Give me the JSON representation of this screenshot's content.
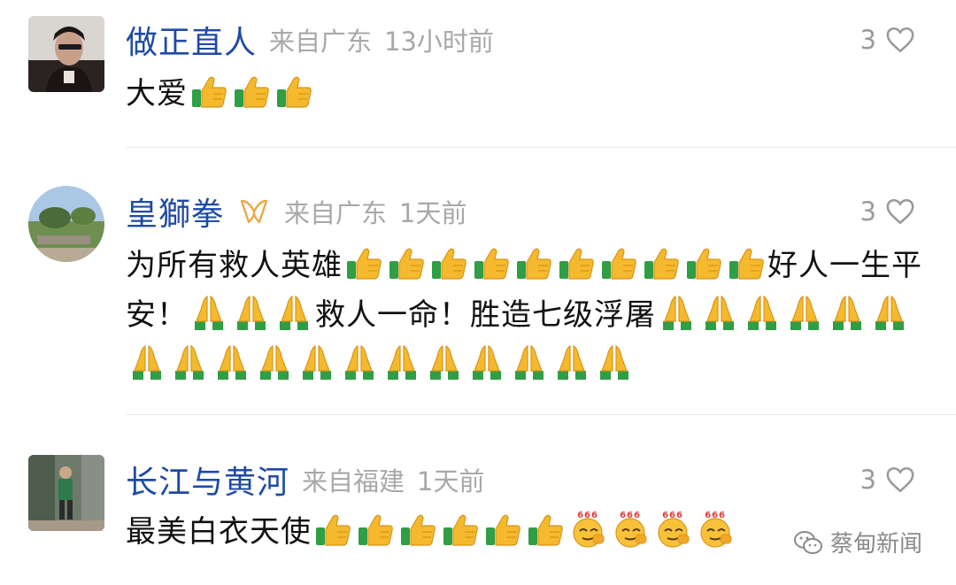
{
  "comments": [
    {
      "username": "做正直人",
      "location": "来自广东",
      "time": "13小时前",
      "likes": "3",
      "text": "大爱",
      "text_emojis": [
        "thumbs-up",
        "thumbs-up",
        "thumbs-up"
      ]
    },
    {
      "username": "皇獅拳",
      "location": "来自广东",
      "time": "1天前",
      "likes": "3",
      "text_parts": [
        {
          "t": "text",
          "v": "为所有救人英雄"
        },
        {
          "t": "emoji",
          "v": "thumbs-up",
          "n": 10
        },
        {
          "t": "text",
          "v": "好人一生平安！"
        },
        {
          "t": "emoji",
          "v": "pray",
          "n": 3
        },
        {
          "t": "text",
          "v": "救人一命！胜造七级浮屠"
        },
        {
          "t": "emoji",
          "v": "pray",
          "n": 18
        }
      ]
    },
    {
      "username": "长江与黄河",
      "location": "来自福建",
      "time": "1天前",
      "likes": "3",
      "text_parts": [
        {
          "t": "text",
          "v": "最美白衣天使"
        },
        {
          "t": "emoji",
          "v": "thumbs-up",
          "n": 6
        },
        {
          "t": "emoji",
          "v": "666-face",
          "n": 4
        }
      ]
    }
  ],
  "watermark": {
    "label": "蔡甸新闻",
    "icon": "wechat-icon"
  },
  "colors": {
    "username": "#1f4aa6",
    "meta": "#a8a8a8",
    "text": "#111111",
    "badge": "#e8a94a"
  }
}
